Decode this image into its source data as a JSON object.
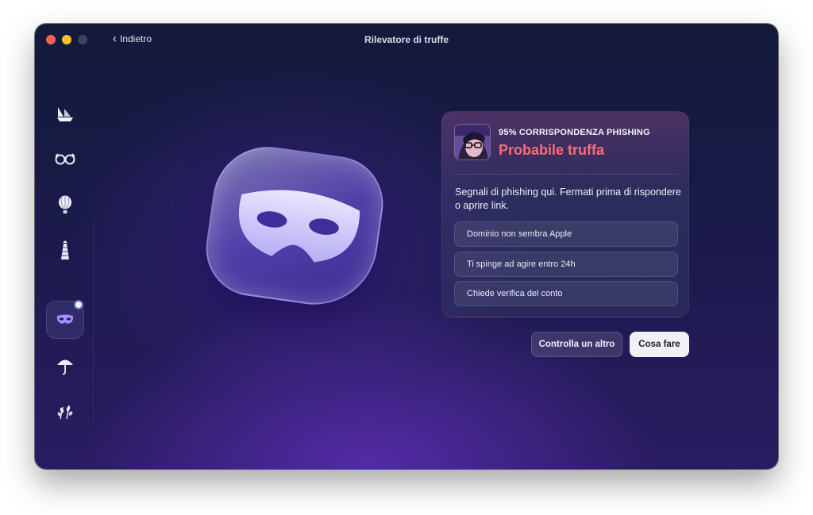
{
  "window": {
    "title": "Rilevatore di truffe",
    "back_label": "Indietro"
  },
  "sidebar": {
    "items": [
      {
        "icon": "ship-icon",
        "glyph": "⛵"
      },
      {
        "icon": "glasses-icon",
        "glyph": "👓"
      },
      {
        "icon": "balloon-icon",
        "glyph": "🎈"
      },
      {
        "icon": "lighthouse-icon",
        "glyph": "🗼"
      },
      {
        "icon": "mask-icon",
        "glyph": "🎭",
        "active": true
      },
      {
        "icon": "umbrella-icon",
        "glyph": "☂"
      },
      {
        "icon": "wheat-icon",
        "glyph": "🌾"
      }
    ]
  },
  "result": {
    "match_label": "95% CORRISPONDENZA PHISHING",
    "verdict": "Probabile truffa",
    "verdict_color": "#ff6b78",
    "description": "Segnali di phishing qui. Fermati prima di rispondere o aprire link.",
    "signals": [
      "Dominio non sembra Apple",
      "Ti spinge ad agire entro 24h",
      "Chiede verifica del conto"
    ]
  },
  "actions": {
    "secondary_label": "Controlla un altro",
    "primary_label": "Cosa fare"
  }
}
